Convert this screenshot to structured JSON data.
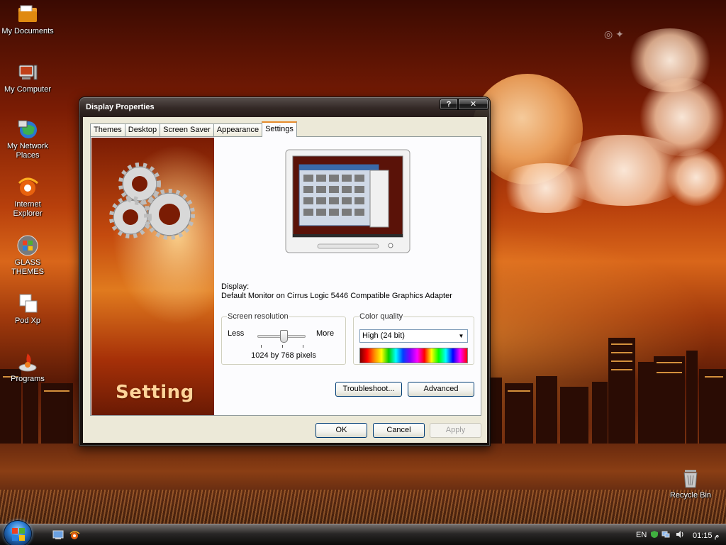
{
  "desktop": {
    "icons": [
      {
        "label": "My Documents"
      },
      {
        "label": "My Computer"
      },
      {
        "label": "My Network Places"
      },
      {
        "label": "Internet Explorer"
      },
      {
        "label": "GLASS THEMES"
      },
      {
        "label": "Pod Xp"
      },
      {
        "label": "Programs"
      },
      {
        "label": "Recycle Bin"
      }
    ]
  },
  "dialog": {
    "title": "Display Properties",
    "help_label": "?",
    "close_label": "✕",
    "tabs": [
      {
        "label": "Themes"
      },
      {
        "label": "Desktop"
      },
      {
        "label": "Screen Saver"
      },
      {
        "label": "Appearance"
      },
      {
        "label": "Settings",
        "active": true
      }
    ],
    "side_image_title": "Setting",
    "display_label": "Display:",
    "display_value": "Default Monitor on Cirrus Logic 5446 Compatible Graphics Adapter",
    "screen_resolution": {
      "legend": "Screen resolution",
      "less": "Less",
      "more": "More",
      "value_text": "1024 by 768 pixels",
      "slider_level": 0.55
    },
    "color_quality": {
      "legend": "Color quality",
      "selected": "High (24 bit)"
    },
    "buttons": {
      "troubleshoot": "Troubleshoot...",
      "advanced": "Advanced",
      "ok": "OK",
      "cancel": "Cancel",
      "apply": "Apply"
    }
  },
  "taskbar": {
    "language": "EN",
    "clock": "01:15  م"
  }
}
